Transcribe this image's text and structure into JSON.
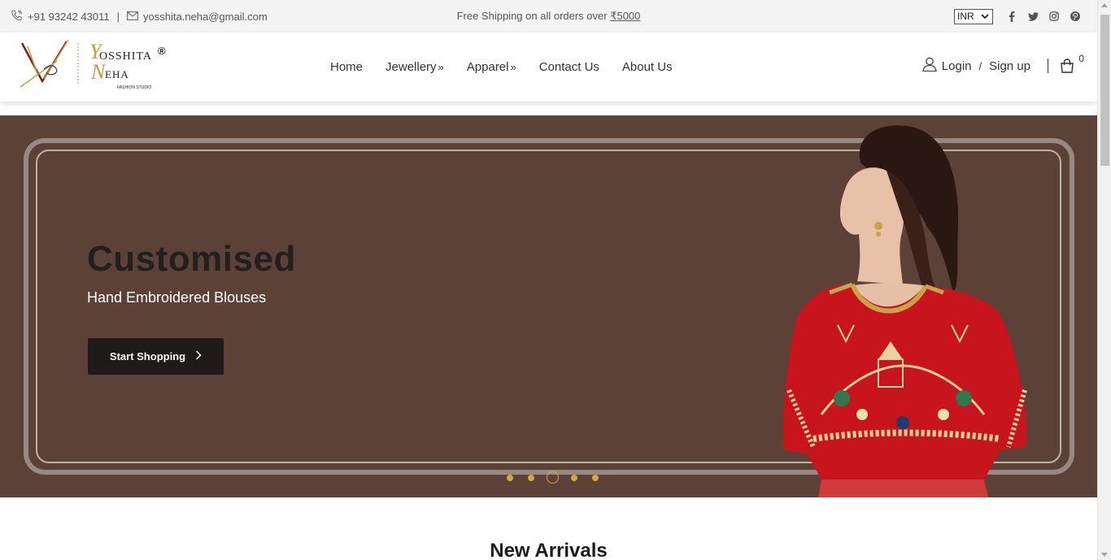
{
  "topbar": {
    "phone": "+91 93242 43011",
    "separator": "|",
    "email": "yosshita.neha@gmail.com",
    "shipping_text": "Free Shipping on all orders over ",
    "shipping_amount": "₹5000",
    "currency": "INR",
    "social_icons": [
      "facebook-icon",
      "twitter-icon",
      "instagram-icon",
      "pinterest-icon"
    ]
  },
  "logo": {
    "line1": "OSSHITA",
    "line1_initial": "Y",
    "line2": "EHA",
    "line2_initial": "N",
    "registered": "®",
    "tagline": "FASHION STUDIO"
  },
  "nav": {
    "items": [
      {
        "label": "Home"
      },
      {
        "label": "Jewellery",
        "submenu": "»"
      },
      {
        "label": "Apparel",
        "submenu": "»"
      },
      {
        "label": "Contact Us"
      },
      {
        "label": "About Us"
      }
    ]
  },
  "account": {
    "login": "Login",
    "slash": "/",
    "signup": "Sign up",
    "cart_count": "0"
  },
  "hero": {
    "title": "Customised",
    "subtitle": "Hand Embroidered Blouses",
    "button_label": "Start Shopping",
    "slide_count": 5,
    "active_slide": 3,
    "bg_color": "#5b4138",
    "accent_color": "#d4a640"
  },
  "section": {
    "title": "New Arrivals"
  }
}
